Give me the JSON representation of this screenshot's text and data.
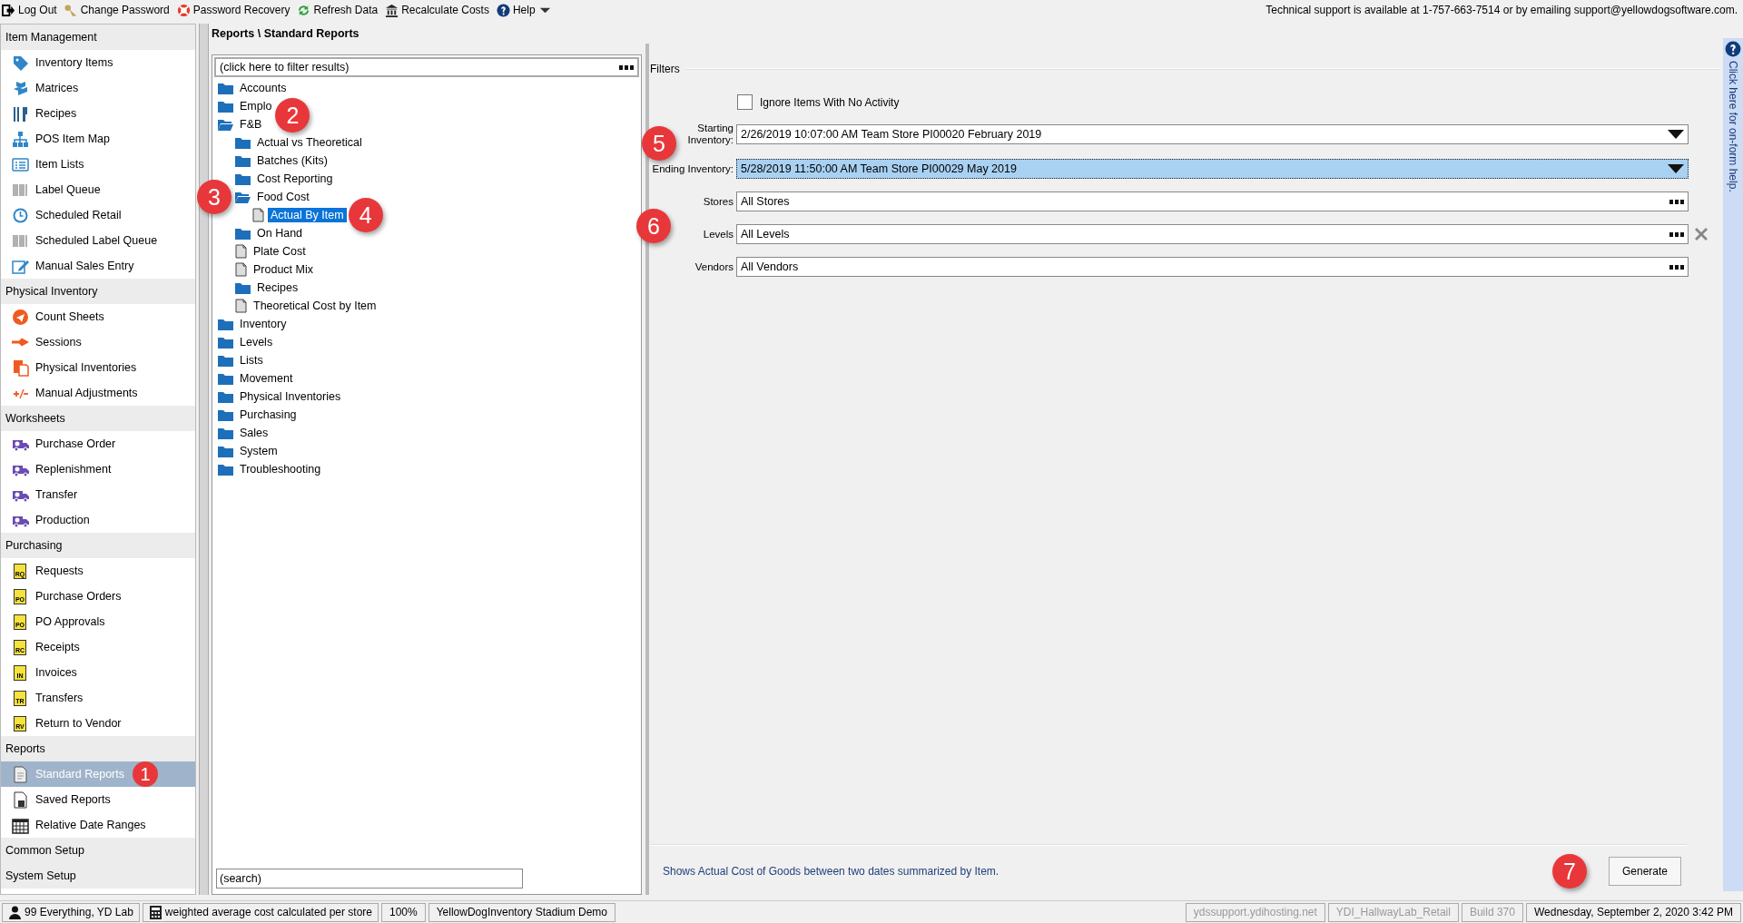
{
  "toolbar": {
    "buttons": [
      {
        "label": "Log Out"
      },
      {
        "label": "Change Password"
      },
      {
        "label": "Password Recovery"
      },
      {
        "label": "Refresh Data"
      },
      {
        "label": "Recalculate Costs"
      },
      {
        "label": "Help",
        "caret": true
      }
    ],
    "support_text": "Technical support is available at 1-757-663-7514 or by emailing support@yellowdogsoftware.com."
  },
  "sidebar": {
    "sections": [
      {
        "title": "Item Management",
        "items": [
          {
            "label": "Inventory Items",
            "selected": false
          },
          {
            "label": "Matrices",
            "selected": false
          },
          {
            "label": "Recipes",
            "selected": false
          },
          {
            "label": "POS Item Map",
            "selected": false
          },
          {
            "label": "Item Lists",
            "selected": false
          },
          {
            "label": "Label Queue",
            "selected": false
          },
          {
            "label": "Scheduled Retail",
            "selected": false
          },
          {
            "label": "Scheduled Label Queue",
            "selected": false
          },
          {
            "label": "Manual Sales Entry",
            "selected": false
          }
        ]
      },
      {
        "title": "Physical Inventory",
        "items": [
          {
            "label": "Count Sheets",
            "selected": false
          },
          {
            "label": "Sessions",
            "selected": false
          },
          {
            "label": "Physical Inventories",
            "selected": false
          },
          {
            "label": "Manual Adjustments",
            "selected": false
          }
        ]
      },
      {
        "title": "Worksheets",
        "items": [
          {
            "label": "Purchase Order",
            "selected": false
          },
          {
            "label": "Replenishment",
            "selected": false
          },
          {
            "label": "Transfer",
            "selected": false
          },
          {
            "label": "Production",
            "selected": false
          }
        ]
      },
      {
        "title": "Purchasing",
        "items": [
          {
            "label": "Requests",
            "icon_text": "RQ",
            "selected": false
          },
          {
            "label": "Purchase Orders",
            "icon_text": "PO",
            "selected": false
          },
          {
            "label": "PO Approvals",
            "icon_text": "PO",
            "selected": false
          },
          {
            "label": "Receipts",
            "icon_text": "RC",
            "selected": false
          },
          {
            "label": "Invoices",
            "icon_text": "IN",
            "selected": false
          },
          {
            "label": "Transfers",
            "icon_text": "TR",
            "selected": false
          },
          {
            "label": "Return to Vendor",
            "icon_text": "RV",
            "selected": false
          }
        ]
      },
      {
        "title": "Reports",
        "items": [
          {
            "label": "Standard Reports",
            "selected": true
          },
          {
            "label": "Saved Reports",
            "selected": false
          },
          {
            "label": "Relative Date Ranges",
            "selected": false
          }
        ]
      },
      {
        "title": "Common Setup"
      },
      {
        "title": "System Setup"
      }
    ]
  },
  "breadcrumb": "Reports \\ Standard Reports",
  "tree": {
    "filter_placeholder": "(click here to filter results)",
    "search_placeholder": "(search)",
    "nodes": [
      {
        "label": "Accounts",
        "kind": "folder",
        "expanded": false,
        "selected": false
      },
      {
        "label": "Emplo",
        "kind": "folder",
        "expanded": false,
        "selected": false
      },
      {
        "label": "F&B",
        "kind": "folder",
        "expanded": true,
        "selected": false,
        "children": [
          {
            "label": "Actual vs Theoretical",
            "kind": "folder",
            "expanded": false,
            "selected": false
          },
          {
            "label": "Batches (Kits)",
            "kind": "folder",
            "expanded": false,
            "selected": false
          },
          {
            "label": "Cost Reporting",
            "kind": "folder",
            "expanded": false,
            "selected": false
          },
          {
            "label": "Food Cost",
            "kind": "folder",
            "expanded": true,
            "selected": false,
            "children": [
              {
                "label": "Actual By Item",
                "kind": "report",
                "selected": true
              }
            ]
          },
          {
            "label": "On Hand",
            "kind": "folder",
            "expanded": false,
            "selected": false
          },
          {
            "label": "Plate Cost",
            "kind": "report",
            "selected": false
          },
          {
            "label": "Product Mix",
            "kind": "report",
            "selected": false
          },
          {
            "label": "Recipes",
            "kind": "folder",
            "expanded": false,
            "selected": false
          },
          {
            "label": "Theoretical Cost by Item",
            "kind": "report",
            "selected": false
          }
        ]
      },
      {
        "label": "Inventory",
        "kind": "folder",
        "expanded": false,
        "selected": false
      },
      {
        "label": "Levels",
        "kind": "folder",
        "expanded": false,
        "selected": false
      },
      {
        "label": "Lists",
        "kind": "folder",
        "expanded": false,
        "selected": false
      },
      {
        "label": "Movement",
        "kind": "folder",
        "expanded": false,
        "selected": false
      },
      {
        "label": "Physical Inventories",
        "kind": "folder",
        "expanded": false,
        "selected": false
      },
      {
        "label": "Purchasing",
        "kind": "folder",
        "expanded": false,
        "selected": false
      },
      {
        "label": "Sales",
        "kind": "folder",
        "expanded": false,
        "selected": false
      },
      {
        "label": "System",
        "kind": "folder",
        "expanded": false,
        "selected": false
      },
      {
        "label": "Troubleshooting",
        "kind": "folder",
        "expanded": false,
        "selected": false
      }
    ]
  },
  "filters": {
    "title": "Filters",
    "checkbox": {
      "label": "Ignore Items With No Activity",
      "checked": false
    },
    "fields": [
      {
        "kind": "dropdown",
        "label": "Starting Inventory:",
        "value": "2/26/2019 10:07:00 AM Team Store PI00020 February 2019",
        "focused": false,
        "clearable": false
      },
      {
        "kind": "dropdown",
        "label": "Ending Inventory:",
        "value": "5/28/2019 11:50:00 AM Team Store PI00029 May 2019",
        "focused": true,
        "clearable": false
      },
      {
        "kind": "picker",
        "label": "Stores",
        "value": "All Stores",
        "focused": false,
        "clearable": false
      },
      {
        "kind": "picker",
        "label": "Levels",
        "value": "All Levels",
        "focused": false,
        "clearable": true
      },
      {
        "kind": "picker",
        "label": "Vendors",
        "value": "All Vendors",
        "focused": false,
        "clearable": false
      }
    ]
  },
  "description": "Shows Actual Cost of Goods between two dates summarized by Item.",
  "generate_button": "Generate",
  "help_strip": "Click here for on-form help.",
  "callouts": [
    {
      "label": "1"
    },
    {
      "label": "2"
    },
    {
      "label": "3"
    },
    {
      "label": "4"
    },
    {
      "label": "5"
    },
    {
      "label": "6"
    },
    {
      "label": "7"
    }
  ],
  "status_bar": {
    "left": [
      {
        "text": "99 Everything, YD Lab",
        "kind": "user",
        "disabled": false
      },
      {
        "text": "weighted average cost calculated per store",
        "kind": "calc",
        "disabled": false
      },
      {
        "text": "100%",
        "kind": "plain",
        "disabled": false
      },
      {
        "text": "YellowDogInventory Stadium Demo",
        "kind": "plain",
        "disabled": false
      }
    ],
    "right": [
      {
        "text": "ydssupport.ydihosting.net",
        "kind": "plain",
        "disabled": true
      },
      {
        "text": "YDI_HallwayLab_Retail",
        "kind": "plain",
        "disabled": true
      },
      {
        "text": "Build 370",
        "kind": "plain",
        "disabled": true
      },
      {
        "text": "Wednesday, September 2, 2020 3:42 PM",
        "kind": "plain",
        "disabled": false
      }
    ]
  }
}
